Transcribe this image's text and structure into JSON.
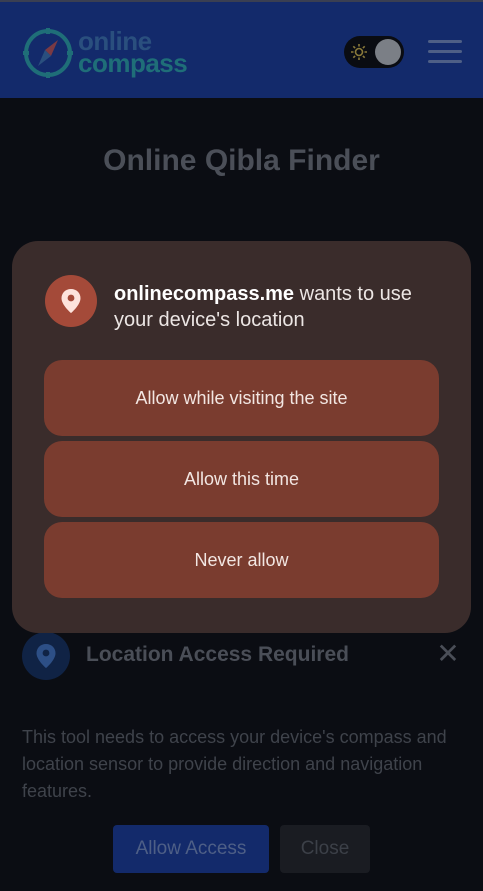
{
  "header": {
    "logo_line1": "online",
    "logo_line2": "compass"
  },
  "page": {
    "title": "Online Qibla Finder"
  },
  "dialog": {
    "site": "onlinecompass.me",
    "message": " wants to use your device's location",
    "buttons": [
      "Allow while visiting the site",
      "Allow this time",
      "Never allow"
    ],
    "accent_color": "#a44a39"
  },
  "location_prompt": {
    "title": "Location Access Required",
    "description": "This tool needs to access your device's compass and location sensor to provide direction and navigation features.",
    "allow_label": "Allow Access",
    "close_label": "Close"
  },
  "icons": {
    "logo": "compass-logo-icon",
    "theme": "sun-icon",
    "menu": "hamburger-menu-icon",
    "location": "location-pin-icon",
    "close": "close-icon"
  }
}
